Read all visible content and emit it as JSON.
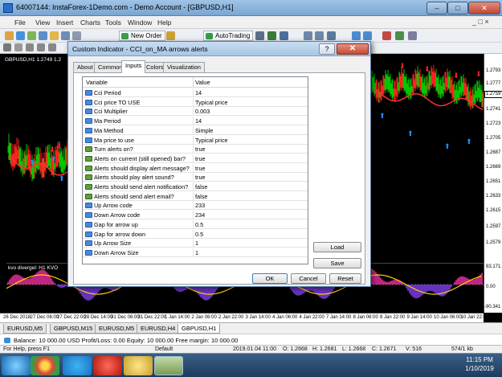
{
  "window": {
    "title": "64007144: InstaForex-1Demo.com - Demo Account - [GBPUSD,H1]",
    "minimize_glyph": "–",
    "maximize_glyph": "□",
    "close_glyph": "✕"
  },
  "menu": {
    "items": [
      "File",
      "View",
      "Insert",
      "Charts",
      "Tools",
      "Window",
      "Help"
    ],
    "mdi_controls": "_ □ ×"
  },
  "toolbar": {
    "new_order_label": "New Order",
    "autotrading_label": "AutoTrading"
  },
  "chart": {
    "symbol_label": "GBPUSD,H1  1.2749 1.2",
    "indicator_label": "kvo divergel: H1  KVO",
    "price_labels": [
      "1.2793",
      "1.2777",
      "1.2759",
      "1.2741",
      "1.2723",
      "1.2705",
      "1.2687",
      "1.2669",
      "1.2651",
      "1.2633",
      "1.2615",
      "1.2597",
      "1.2579"
    ],
    "current_price": "1.2759",
    "sub_labels": [
      "83.171",
      "0.00",
      "-90.341"
    ],
    "time_labels": [
      "26 Dec 2018",
      "27 Dec 06:00",
      "27 Dec 22:00",
      "28 Dec 14:00",
      "31 Dec 06:00",
      "31 Dec 22:00",
      "1 Jan 14:00",
      "2 Jan 06:00",
      "2 Jan 22:00",
      "3 Jan 14:00",
      "4 Jan 06:00",
      "4 Jan 22:00",
      "7 Jan 14:00",
      "8 Jan 06:00",
      "8 Jan 22:00",
      "9 Jan 14:00",
      "10 Jan 06:00",
      "10 Jan 22:00"
    ],
    "colors": {
      "bull": "#00c800",
      "bear": "#ff2020",
      "ma": "#ff3030",
      "arrow_up": "#1e90ff",
      "arrow_down": "#ff2020"
    }
  },
  "dialog": {
    "title": "Custom Indicator - CCI_on_MA arrows alerts",
    "help_glyph": "?",
    "close_glyph": "✕",
    "tabs": [
      "About",
      "Common",
      "Inputs",
      "Colors",
      "Visualization"
    ],
    "active_tab": "Inputs",
    "columns": {
      "variable": "Variable",
      "value": "Value"
    },
    "rows": [
      {
        "type": "num",
        "name": "Cci Period",
        "value": "14"
      },
      {
        "type": "num",
        "name": "Cci price TO USE",
        "value": "Typical price"
      },
      {
        "type": "num",
        "name": "Cci Multiplier",
        "value": "0.003"
      },
      {
        "type": "num",
        "name": "Ma Period",
        "value": "14"
      },
      {
        "type": "num",
        "name": "Ma Method",
        "value": "Simple"
      },
      {
        "type": "num",
        "name": "Ma price to use",
        "value": "Typical price"
      },
      {
        "type": "bool",
        "name": "Turn alerts on?",
        "value": "true"
      },
      {
        "type": "bool",
        "name": "Alerts on current (still opened) bar?",
        "value": "true"
      },
      {
        "type": "bool",
        "name": "Alerts should display alert message?",
        "value": "true"
      },
      {
        "type": "bool",
        "name": "Alerts should play alert sound?",
        "value": "true"
      },
      {
        "type": "bool",
        "name": "Alerts should send alert notification?",
        "value": "false"
      },
      {
        "type": "bool",
        "name": "Alerts should send alert email?",
        "value": "false"
      },
      {
        "type": "num",
        "name": "Up Arrow code",
        "value": "233"
      },
      {
        "type": "num",
        "name": "Down Arrow code",
        "value": "234"
      },
      {
        "type": "num",
        "name": "Gap for arrow up",
        "value": "0.5"
      },
      {
        "type": "num",
        "name": "Gap for arrow down",
        "value": "0.5"
      },
      {
        "type": "num",
        "name": "Up Arrow Size",
        "value": "1"
      },
      {
        "type": "num",
        "name": "Down Arrow Size",
        "value": "1"
      }
    ],
    "buttons": {
      "load": "Load",
      "save": "Save",
      "ok": "OK",
      "cancel": "Cancel",
      "reset": "Reset"
    }
  },
  "symbol_tabs": [
    "EURUSD,M5",
    "GBPUSD,M15",
    "EURUSD,M5",
    "EURUSD,H4",
    "GBPUSD,H1"
  ],
  "active_symbol_tab": "GBPUSD,H1",
  "balance_text": "Balance: 10 000.00 USD  Profit/Loss: 0.00  Equity: 10 000.00  Free margin: 10 000.00",
  "status": {
    "help": "For Help, press F1",
    "profile": "Default",
    "datetime": "2019.01.04 11:00",
    "open": "O: 1.2668",
    "high": "H: 1.2681",
    "low": "L: 1.2668",
    "close": "C: 1.2671",
    "volume": "V: 516",
    "traffic": "574/1 kb"
  },
  "taskbar": {
    "time": "11:15 PM",
    "date": "1/10/2019"
  }
}
